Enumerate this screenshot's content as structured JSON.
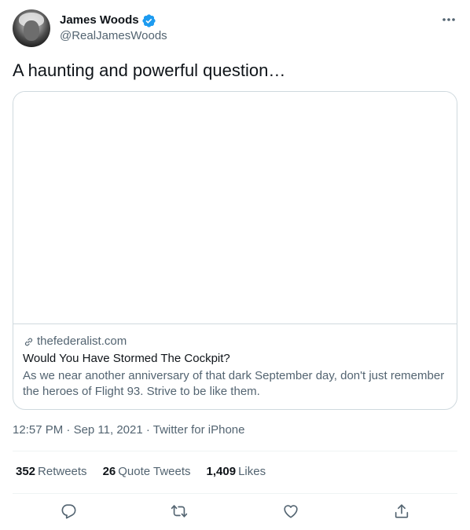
{
  "author": {
    "display_name": "James Woods",
    "handle": "@RealJamesWoods",
    "verified": true
  },
  "tweet": {
    "text": "A haunting and powerful question…"
  },
  "card": {
    "domain": "thefederalist.com",
    "title": "Would You Have Stormed The Cockpit?",
    "description": "As we near another anniversary of that dark September day, don't just remember the heroes of Flight 93. Strive to be like them."
  },
  "meta": {
    "time": "12:57 PM",
    "separator": " · ",
    "date": "Sep 11, 2021",
    "source": "Twitter for iPhone"
  },
  "stats": {
    "retweets_count": "352",
    "retweets_label": "Retweets",
    "quotes_count": "26",
    "quotes_label": "Quote Tweets",
    "likes_count": "1,409",
    "likes_label": "Likes"
  },
  "actions": {
    "icons": [
      "reply-icon",
      "retweet-icon",
      "like-icon",
      "share-icon"
    ]
  },
  "colors": {
    "verified_blue": "#1d9bf0",
    "text_primary": "#0f1419",
    "text_secondary": "#536471",
    "border": "#cfd9de"
  }
}
